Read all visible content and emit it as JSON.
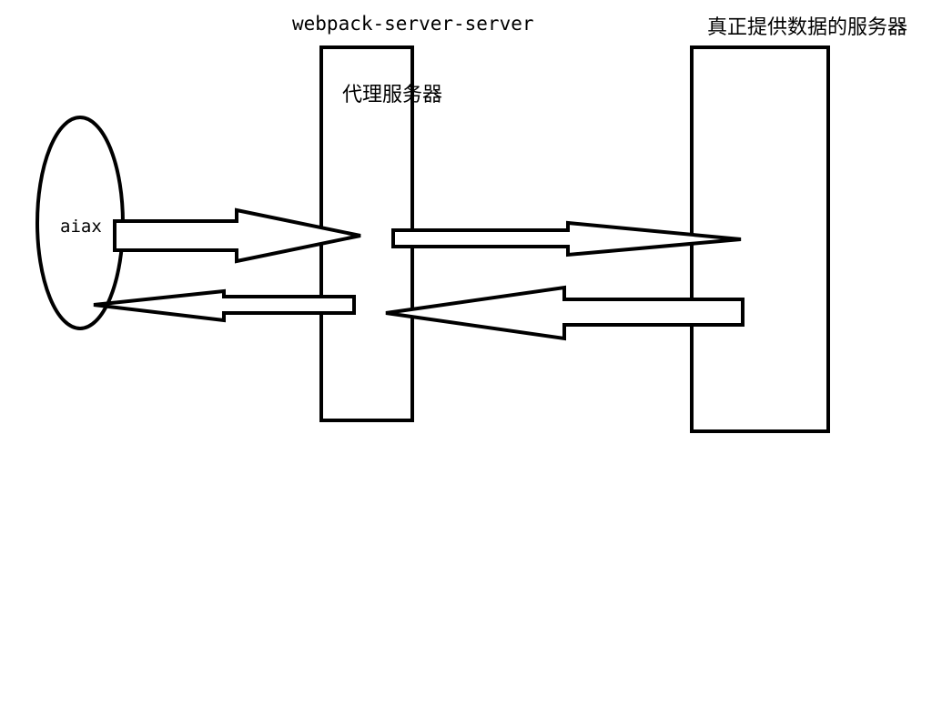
{
  "diagram": {
    "title": "webpack-server-server",
    "proxy_server_label": "代理服务器",
    "real_server_label": "真正提供数据的服务器",
    "client_label": "aiax"
  },
  "colors": {
    "stroke": "#000000",
    "background": "#ffffff"
  }
}
